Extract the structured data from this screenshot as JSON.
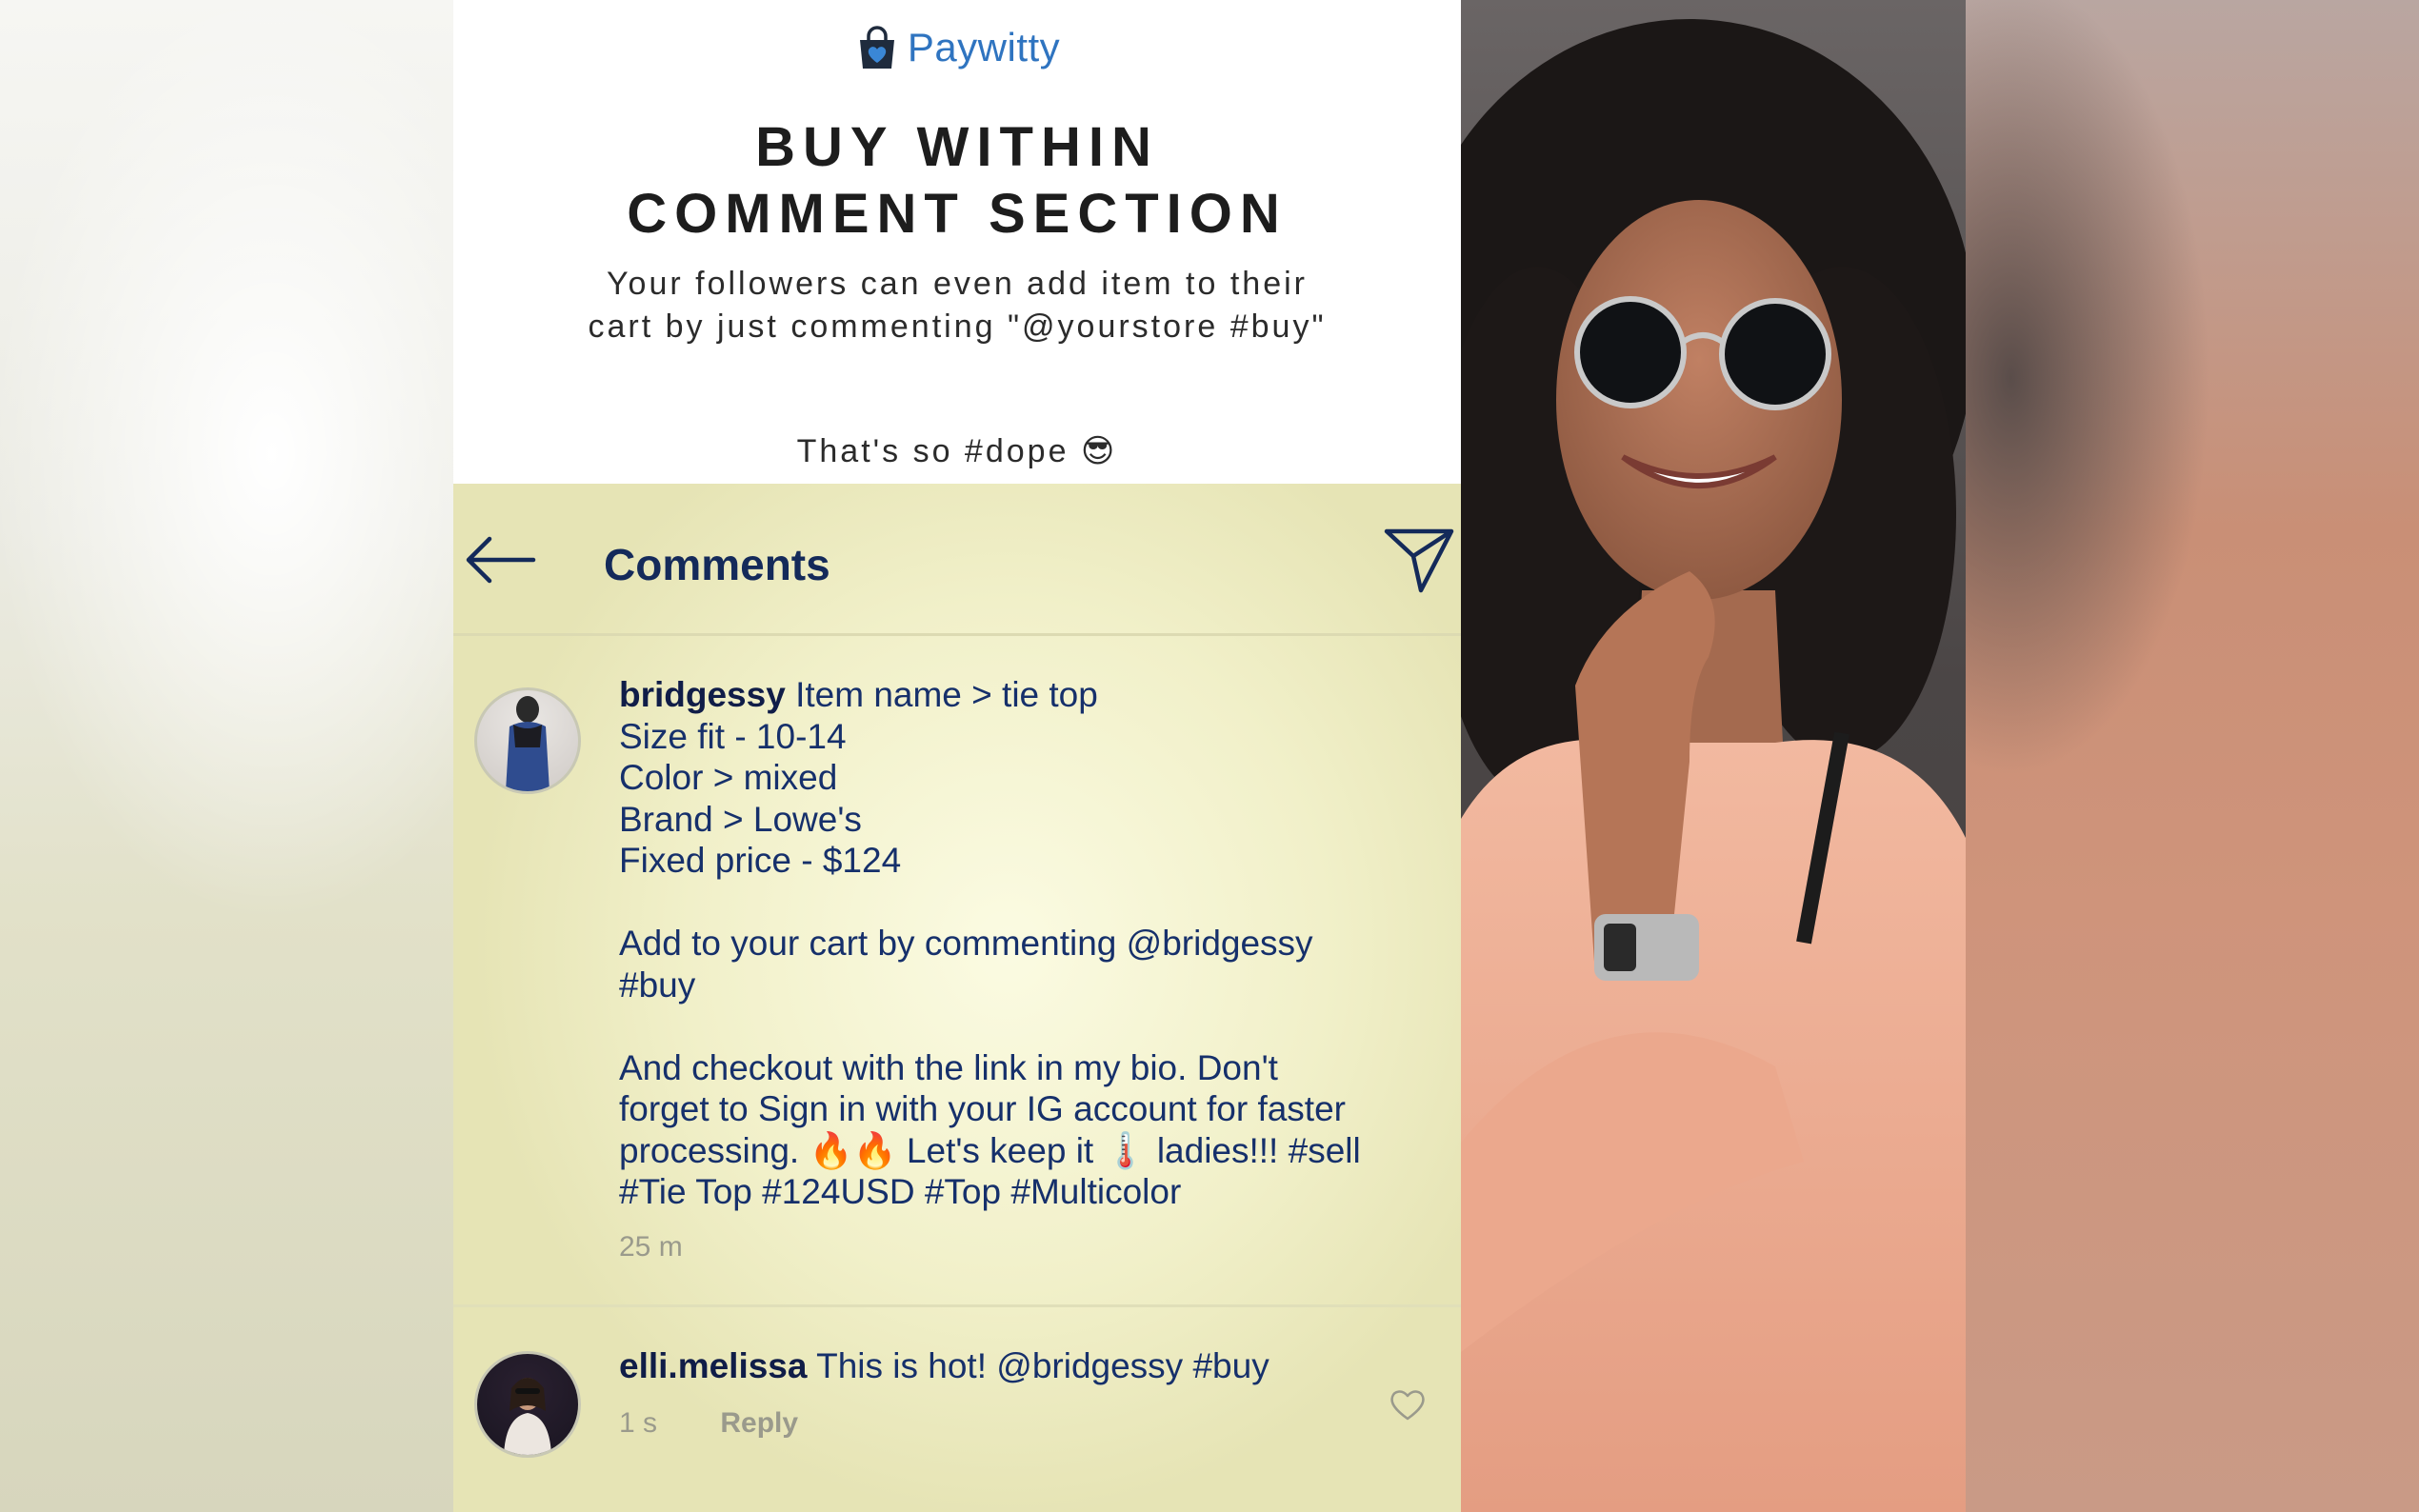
{
  "brand": {
    "name": "Paywitty",
    "icon": "shopping-bag-heart-icon",
    "color": "#2f74c0"
  },
  "headline": {
    "line1": "BUY WITHIN",
    "line2": "COMMENT SECTION"
  },
  "subline": "Your followers can even add item to their cart by just commenting \"@yourstore #buy\"",
  "tagline": "That's so #dope 😎",
  "comments_screen": {
    "title": "Comments",
    "back_icon": "arrow-left-icon",
    "send_icon": "paper-plane-icon",
    "comments": [
      {
        "username": "bridgessy",
        "lines": [
          "Item name > tie top",
          "Size fit - 10-14",
          "Color > mixed",
          "Brand > Lowe's",
          "Fixed price - $124",
          "",
          "Add to your cart by commenting @bridgessy",
          "#buy",
          "",
          "And checkout with the link in my bio. Don't",
          "forget to Sign in with your IG account for faster",
          "processing. 🔥🔥 Let's keep it 🌡️ ladies!!! #sell",
          "#Tie Top #124USD #Top #Multicolor"
        ],
        "time": "25 m"
      },
      {
        "username": "elli.melissa",
        "text": "This is hot! @bridgessy #buy",
        "time": "1 s",
        "reply_label": "Reply",
        "like_icon": "heart-outline-icon"
      }
    ]
  },
  "colors": {
    "comment_text": "#16306b",
    "panel_background": "#f1f0c9",
    "headline": "#1d1d1d"
  }
}
